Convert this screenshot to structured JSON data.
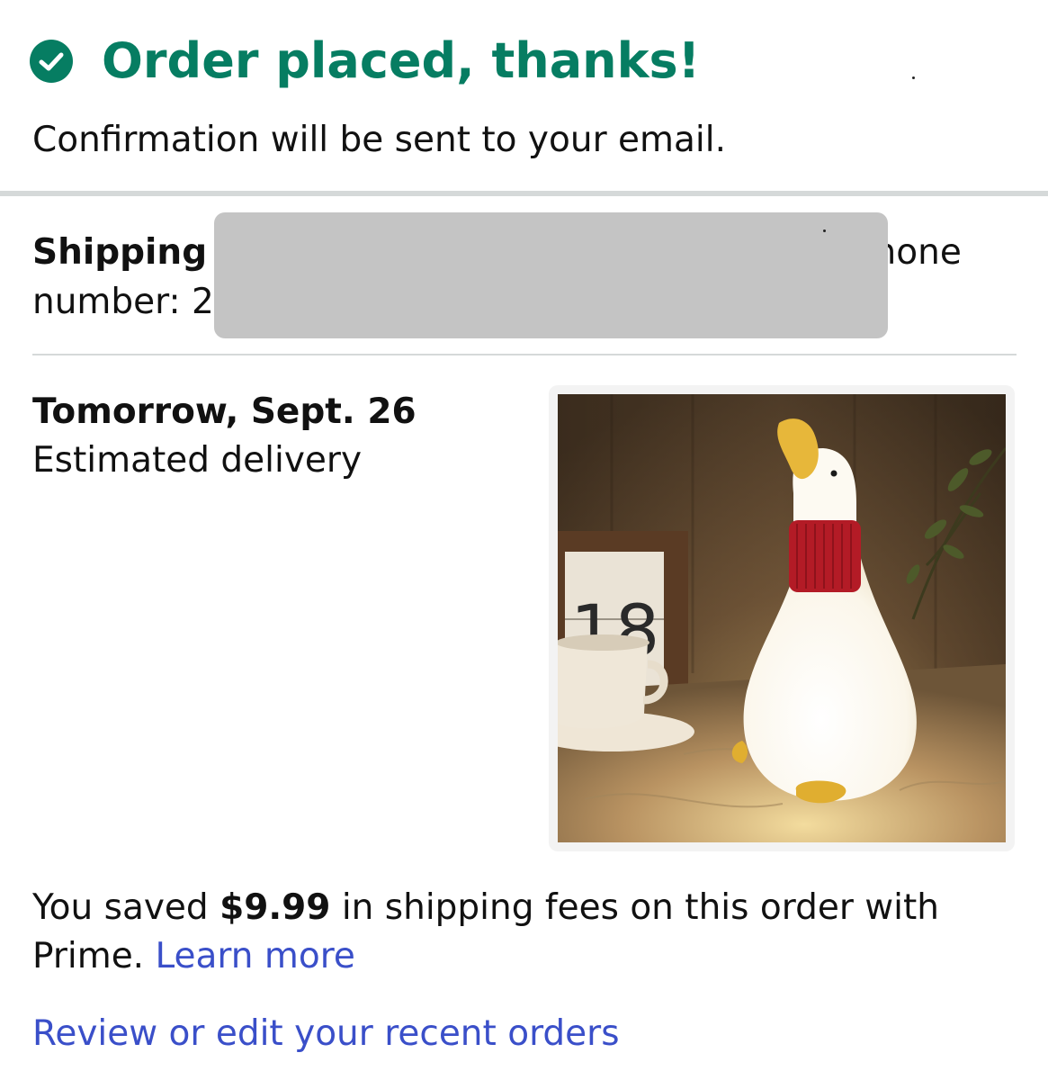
{
  "header": {
    "title": "Order placed, thanks!",
    "subtitle": "Confirmation will be sent to your email."
  },
  "shipping": {
    "label": "Shipping t",
    "phone_fragment": "Phone",
    "number_fragment": "number: 2"
  },
  "delivery": {
    "date": "Tomorrow, Sept. 26",
    "label": "Estimated delivery"
  },
  "product": {
    "image_desc": "duck-night-lamp-photo",
    "calendar_digits": "18"
  },
  "savings": {
    "prefix": "You saved ",
    "amount": "$9.99",
    "suffix": " in shipping fees on this order with Prime.",
    "learn_more": "Learn more"
  },
  "links": {
    "review_orders": "Review or edit your recent orders"
  },
  "colors": {
    "success_green": "#067d62",
    "link_blue": "#3a4fc9",
    "divider_gray": "#d5d9d9",
    "redaction_gray": "#c4c4c4"
  }
}
